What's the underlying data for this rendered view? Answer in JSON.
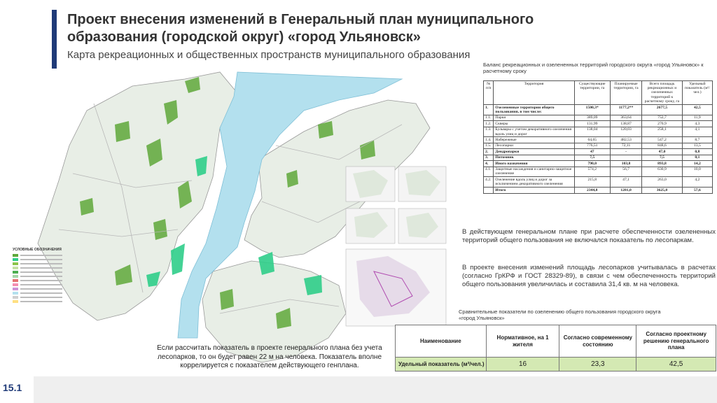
{
  "title": "Проект внесения изменений в Генеральный план муниципального образования (городской округ) «город Ульяновск»",
  "subtitle": "Карта рекреационных и общественных пространств муниципального образования",
  "colors": {
    "accent": "#1f3a78",
    "green": "#5fa83a",
    "park": "#2fce8a",
    "water": "#b3e0ee",
    "compare_row": "#d4e9b3"
  },
  "legend": {
    "title": "УСЛОВНЫЕ ОБОЗНАЧЕНИЯ"
  },
  "map_note": "Если рассчитать показатель в проекте генерального плана без учета лесопарков, то он будет равен 22 м на человека. Показатель вполне коррелируется с показателем действующего генплана.",
  "balance": {
    "caption": "Баланс рекреационных и озелененных территорий городского округа «город Ульяновск» к расчетному сроку",
    "headers": [
      "№ п/п",
      "Территория",
      "Существующие территории, га",
      "Планируемые территории, га",
      "Всего площадь рекреационных и озелененных территорий к расчетному сроку, га",
      "Удельный показатель (м²/чел.)"
    ],
    "rows": [
      [
        "1.",
        "Озелененные территории общего пользования, в том числе:",
        "1500,3*",
        "1177,2**",
        "2677,5",
        "42,5"
      ],
      [
        "1.1.",
        "Парки",
        "389,09",
        "363,64",
        "752,7",
        "11,9"
      ],
      [
        "1.2.",
        "Скверы",
        "131,99",
        "138,87",
        "270,9",
        "4,3"
      ],
      [
        "1.3.",
        "Бульвары с учетом декоративного озеленения вдоль улиц и дорог",
        "138,04",
        "120,03",
        "258,1",
        "4,1"
      ],
      [
        "1.4.",
        "Набережные",
        "64,65",
        "482,53",
        "547,2",
        "8,7"
      ],
      [
        "1.5.",
        "Лесопарки",
        "776,51",
        "72,11",
        "848,6",
        "13,5"
      ],
      [
        "2.",
        "Дендропарки",
        "47",
        "-",
        "47,0",
        "0,8"
      ],
      [
        "3.",
        "Питомник",
        "7,5",
        "",
        "7,5",
        "0,1"
      ],
      [
        "4.",
        "Иного назначения",
        "790,0",
        "103,8",
        "893,8",
        "14,2"
      ],
      [
        "4.1.",
        "Защитные насаждения и санитарно-защитное озеленение",
        "574,2",
        "56,7",
        "630,9",
        "10,0"
      ],
      [
        "4.2.",
        "Озеленение вдоль улиц и дорог за исключением декоративного озеленения",
        "215,8",
        "47,1",
        "263,0",
        "4,2"
      ],
      [
        "",
        "Итого",
        "2344,8",
        "1281,0",
        "3625,8",
        "57,6"
      ]
    ]
  },
  "para1": "В действующем генеральном плане при расчете обеспеченности озелененных территорий общего пользования не включался показатель по лесопаркам.",
  "para2": "В проекте внесения изменений площадь лесопарков учитывалась в расчетах (согласно ГрКРФ и ГОСТ 28329-89), в связи с чем обеспеченность территорий общего пользования увеличилась и составила 31,4 кв. м на человека.",
  "compare": {
    "caption": "Сравнительные показатели по озеленению общего пользования городского округа «город Ульяновск»",
    "headers": [
      "Наименование",
      "Нормативное, на 1 жителя",
      "Согласно современному состоянию",
      "Согласно проектному решению генерального плана"
    ],
    "row": [
      "Удельный показатель (м²/чел.)",
      "16",
      "23,3",
      "42,5"
    ]
  },
  "page_number": "15.1"
}
